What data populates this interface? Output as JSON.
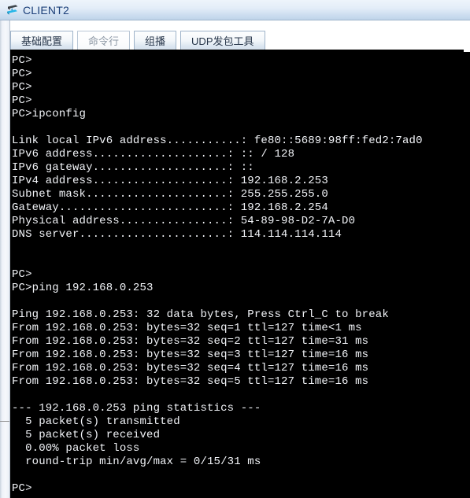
{
  "window": {
    "title": "CLIENT2",
    "icon": "pc-device-icon",
    "title_color": "#1b3f78"
  },
  "tabs": [
    {
      "label": "基础配置",
      "name": "tab-basic-config",
      "active": false
    },
    {
      "label": "命令行",
      "name": "tab-command-line",
      "active": true
    },
    {
      "label": "组播",
      "name": "tab-multicast",
      "active": false
    },
    {
      "label": "UDP发包工具",
      "name": "tab-udp-packet-tool",
      "active": false
    }
  ],
  "terminal": {
    "background": "#000000",
    "foreground": "#f2f4f8",
    "prompt": "PC>",
    "lines": [
      "PC>",
      "PC>",
      "PC>",
      "PC>",
      "PC>ipconfig",
      "",
      "Link local IPv6 address...........: fe80::5689:98ff:fed2:7ad0",
      "IPv6 address....................: :: / 128",
      "IPv6 gateway....................: ::",
      "IPv4 address....................: 192.168.2.253",
      "Subnet mask.....................: 255.255.255.0",
      "Gateway.........................: 192.168.2.254",
      "Physical address................: 54-89-98-D2-7A-D0",
      "DNS server......................: 114.114.114.114",
      "",
      "",
      "PC>",
      "PC>ping 192.168.0.253",
      "",
      "Ping 192.168.0.253: 32 data bytes, Press Ctrl_C to break",
      "From 192.168.0.253: bytes=32 seq=1 ttl=127 time<1 ms",
      "From 192.168.0.253: bytes=32 seq=2 ttl=127 time=31 ms",
      "From 192.168.0.253: bytes=32 seq=3 ttl=127 time=16 ms",
      "From 192.168.0.253: bytes=32 seq=4 ttl=127 time=16 ms",
      "From 192.168.0.253: bytes=32 seq=5 ttl=127 time=16 ms",
      "",
      "--- 192.168.0.253 ping statistics ---",
      "  5 packet(s) transmitted",
      "  5 packet(s) received",
      "  0.00% packet loss",
      "  round-trip min/avg/max = 0/15/31 ms",
      "",
      "PC>"
    ],
    "ipconfig": {
      "command": "ipconfig",
      "link_local_ipv6_address": "fe80::5689:98ff:fed2:7ad0",
      "ipv6_address": ":: / 128",
      "ipv6_gateway": "::",
      "ipv4_address": "192.168.2.253",
      "subnet_mask": "255.255.255.0",
      "gateway": "192.168.2.254",
      "physical_address": "54-89-98-D2-7A-D0",
      "dns_server": "114.114.114.114"
    },
    "ping": {
      "command": "ping 192.168.0.253",
      "target": "192.168.0.253",
      "data_bytes": "32",
      "break_hint": "Press Ctrl_C to break",
      "replies": [
        {
          "from": "192.168.0.253",
          "bytes": "32",
          "seq": "1",
          "ttl": "127",
          "time": "<1 ms"
        },
        {
          "from": "192.168.0.253",
          "bytes": "32",
          "seq": "2",
          "ttl": "127",
          "time": "=31 ms"
        },
        {
          "from": "192.168.0.253",
          "bytes": "32",
          "seq": "3",
          "ttl": "127",
          "time": "=16 ms"
        },
        {
          "from": "192.168.0.253",
          "bytes": "32",
          "seq": "4",
          "ttl": "127",
          "time": "=16 ms"
        },
        {
          "from": "192.168.0.253",
          "bytes": "32",
          "seq": "5",
          "ttl": "127",
          "time": "=16 ms"
        }
      ],
      "statistics_header": "--- 192.168.0.253 ping statistics ---",
      "transmitted": "5 packet(s) transmitted",
      "received": "5 packet(s) received",
      "packet_loss": "0.00% packet loss",
      "round_trip": "round-trip min/avg/max = 0/15/31 ms"
    }
  }
}
